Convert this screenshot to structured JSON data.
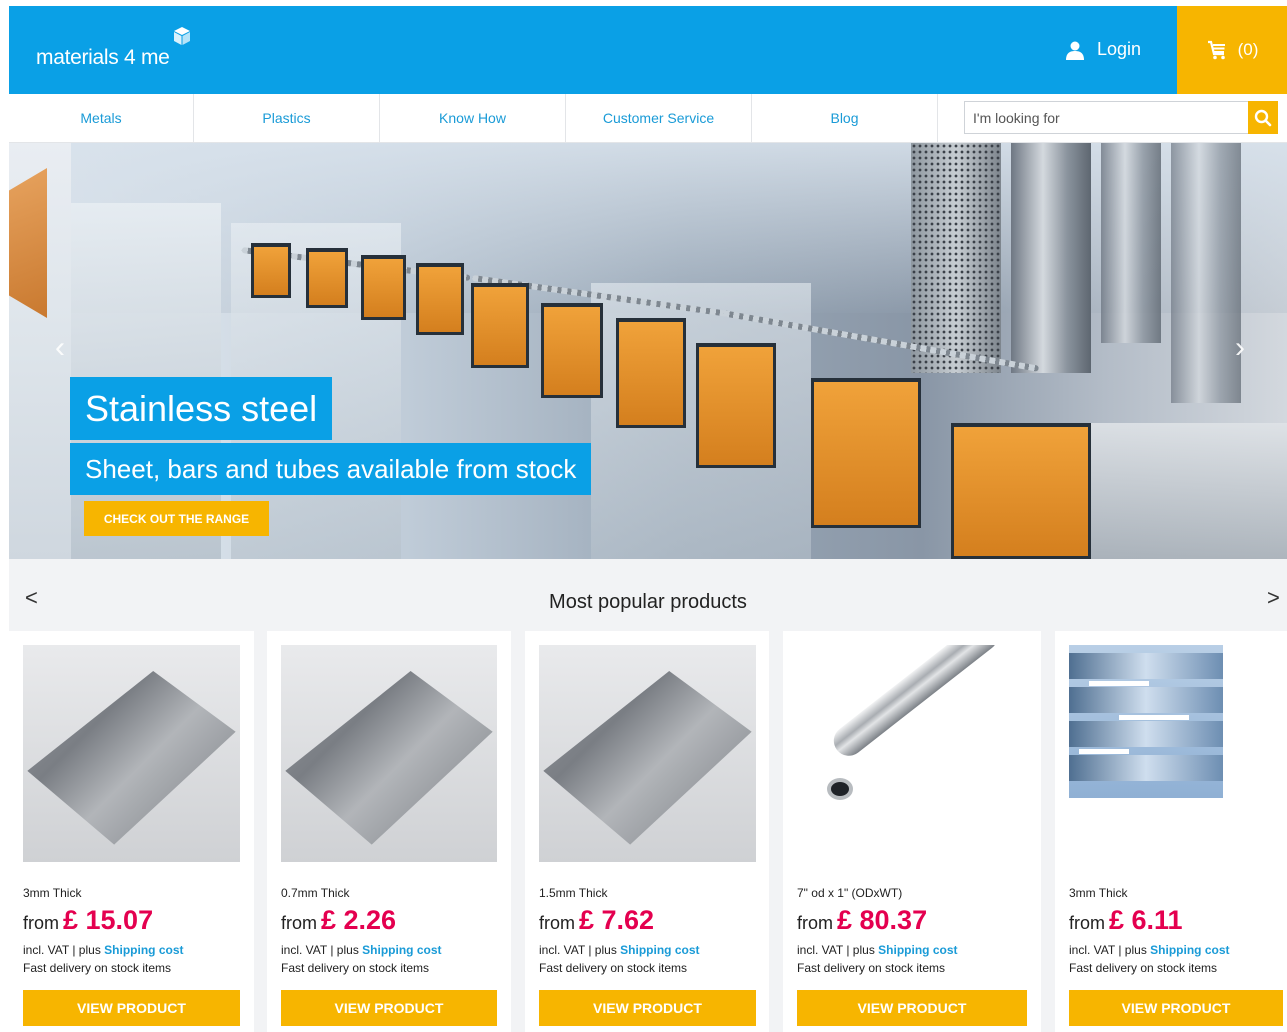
{
  "header": {
    "logo_text": "materials 4 me",
    "login_label": "Login",
    "cart_count": "(0)"
  },
  "nav": {
    "items": [
      {
        "label": "Metals"
      },
      {
        "label": "Plastics"
      },
      {
        "label": "Know How"
      },
      {
        "label": "Customer Service"
      },
      {
        "label": "Blog"
      }
    ],
    "search_placeholder": "I'm looking for"
  },
  "hero": {
    "title": "Stainless steel",
    "subtitle": "Sheet, bars and tubes available from stock",
    "cta_label": "CHECK OUT THE RANGE",
    "prev_arrow": "‹",
    "next_arrow": "›"
  },
  "popular": {
    "title": "Most popular products",
    "prev_arrow": "<",
    "next_arrow": ">",
    "from_label": "from",
    "vat_label": "incl. VAT | plus",
    "shipping_label": "Shipping cost",
    "delivery_label": "Fast delivery on stock items",
    "button_label": "VIEW PRODUCT",
    "products": [
      {
        "name": "3mm Thick",
        "price": "£ 15.07",
        "image": "sheet"
      },
      {
        "name": "0.7mm Thick",
        "price": "£ 2.26",
        "image": "sheet"
      },
      {
        "name": "1.5mm Thick",
        "price": "£ 7.62",
        "image": "sheet"
      },
      {
        "name": "7\" od x 1\" (ODxWT)",
        "price": "£ 80.37",
        "image": "tube"
      },
      {
        "name": "3mm Thick",
        "price": "£ 6.11",
        "image": "bar-stack"
      }
    ]
  },
  "colors": {
    "brand_blue": "#0aa0e6",
    "accent_yellow": "#f7b500",
    "price_red": "#e4004f",
    "link_blue": "#1a9bd7"
  },
  "icons": [
    "logo-cube-icon",
    "user-icon",
    "cart-icon",
    "search-icon",
    "chevron-left-icon",
    "chevron-right-icon"
  ]
}
